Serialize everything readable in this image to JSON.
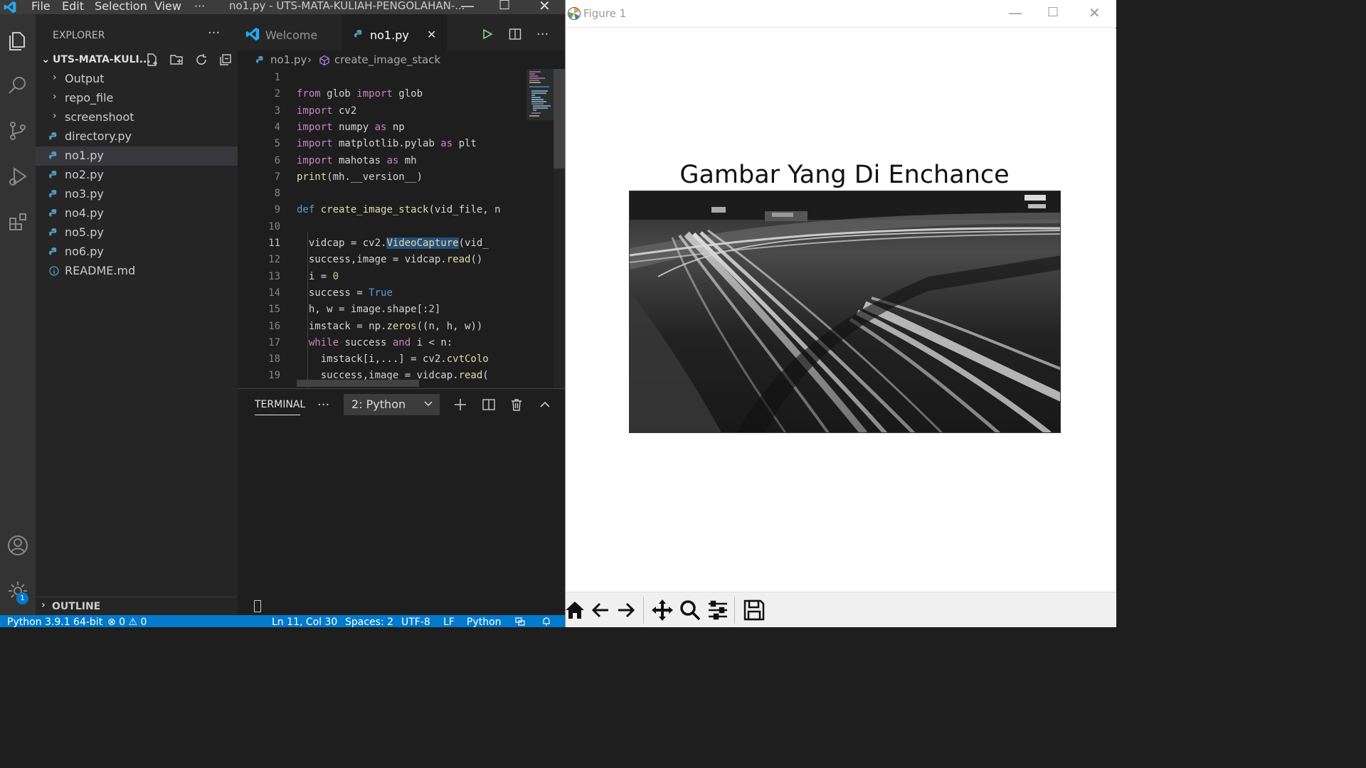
{
  "vscode": {
    "menu": [
      "File",
      "Edit",
      "Selection",
      "View",
      "···"
    ],
    "window_title": "no1.py - UTS-MATA-KULIAH-PENGOLAHAN-...",
    "explorer_title": "EXPLORER",
    "project_name": "UTS-MATA-KULI...",
    "tree": [
      {
        "label": "Output",
        "type": "folder"
      },
      {
        "label": "repo_file",
        "type": "folder"
      },
      {
        "label": "screenshoot",
        "type": "folder"
      },
      {
        "label": "directory.py",
        "type": "python"
      },
      {
        "label": "no1.py",
        "type": "python",
        "selected": true
      },
      {
        "label": "no2.py",
        "type": "python"
      },
      {
        "label": "no3.py",
        "type": "python"
      },
      {
        "label": "no4.py",
        "type": "python"
      },
      {
        "label": "no5.py",
        "type": "python"
      },
      {
        "label": "no6.py",
        "type": "python"
      },
      {
        "label": "README.md",
        "type": "info"
      }
    ],
    "outline_label": "OUTLINE",
    "tabs": [
      {
        "label": "Welcome",
        "active": false
      },
      {
        "label": "no1.py",
        "active": true
      }
    ],
    "tab_close": "✕",
    "breadcrumb": {
      "file": "no1.py",
      "symbol": "create_image_stack"
    },
    "line_numbers": [
      "1",
      "2",
      "3",
      "4",
      "5",
      "6",
      "7",
      "8",
      "9",
      "10",
      "11",
      "12",
      "13",
      "14",
      "15",
      "16",
      "17",
      "18",
      "19"
    ],
    "current_line": "11",
    "code_lines": [
      "",
      "from glob import glob",
      "import cv2",
      "import numpy as np",
      "import matplotlib.pylab as plt",
      "import mahotas as mh",
      "print(mh.__version__)",
      "",
      "def create_image_stack(vid_file, n",
      "",
      "  vidcap = cv2.VideoCapture(vid_",
      "  success,image = vidcap.read()",
      "  i = 0",
      "  success = True",
      "  h, w = image.shape[:2]",
      "  imstack = np.zeros((n, h, w))",
      "  while success and i < n:",
      "    imstack[i,...] = cv2.cvtColo",
      "    success,image = vidcap.read("
    ],
    "panel": {
      "tab": "TERMINAL",
      "more": "···",
      "terminal_select": "2: Python"
    },
    "status": {
      "interpreter": "Python 3.9.1 64-bit",
      "problems": "⊗ 0 ⚠ 0",
      "position": "Ln 11, Col 30",
      "spaces": "Spaces: 2",
      "encoding": "UTF-8",
      "eol": "LF",
      "language": "Python"
    },
    "settings_badge": "1",
    "colors": {
      "accent": "#007acc",
      "editor_bg": "#1e1e1e",
      "sidebar_bg": "#252526",
      "activity_bg": "#333333"
    }
  },
  "figure": {
    "window_title": "Figure 1",
    "plot_title": "Gambar Yang Di Enchance",
    "toolbar": [
      "home-icon",
      "back-icon",
      "forward-icon",
      "pan-icon",
      "zoom-icon",
      "configure-icon",
      "save-icon"
    ]
  }
}
